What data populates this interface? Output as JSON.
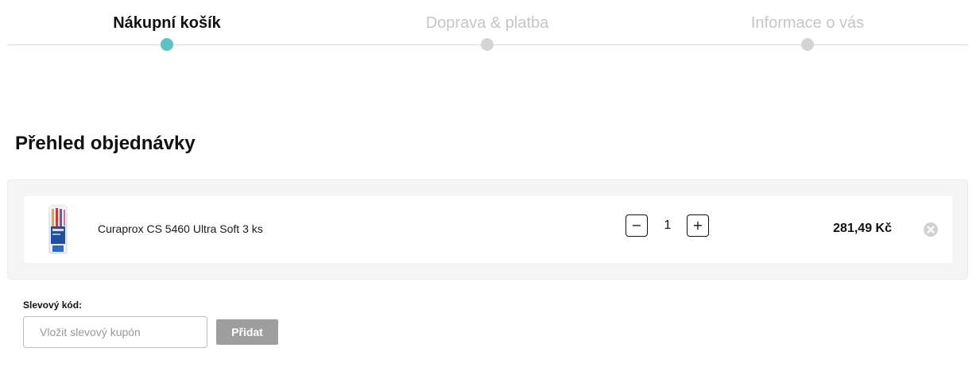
{
  "stepper": {
    "steps": [
      {
        "label": "Nákupní košík",
        "state": "active"
      },
      {
        "label": "Doprava & platba",
        "state": "inactive"
      },
      {
        "label": "Informace o vás",
        "state": "inactive"
      }
    ],
    "active_color": "#5bc3c1",
    "inactive_color": "#d4d4d4"
  },
  "order": {
    "title": "Přehled objednávky",
    "items": [
      {
        "name": "Curaprox CS 5460 Ultra Soft 3 ks",
        "image_icon": "toothbrush-pack-image",
        "quantity": "1",
        "decrease_label": "−",
        "increase_label": "+",
        "price": "281,49 Kč",
        "remove_icon": "close-circle-icon"
      }
    ]
  },
  "coupon": {
    "label": "Slevový kód:",
    "value": "",
    "placeholder": "Vložit slevový kupón",
    "button_label": "Přidat"
  }
}
